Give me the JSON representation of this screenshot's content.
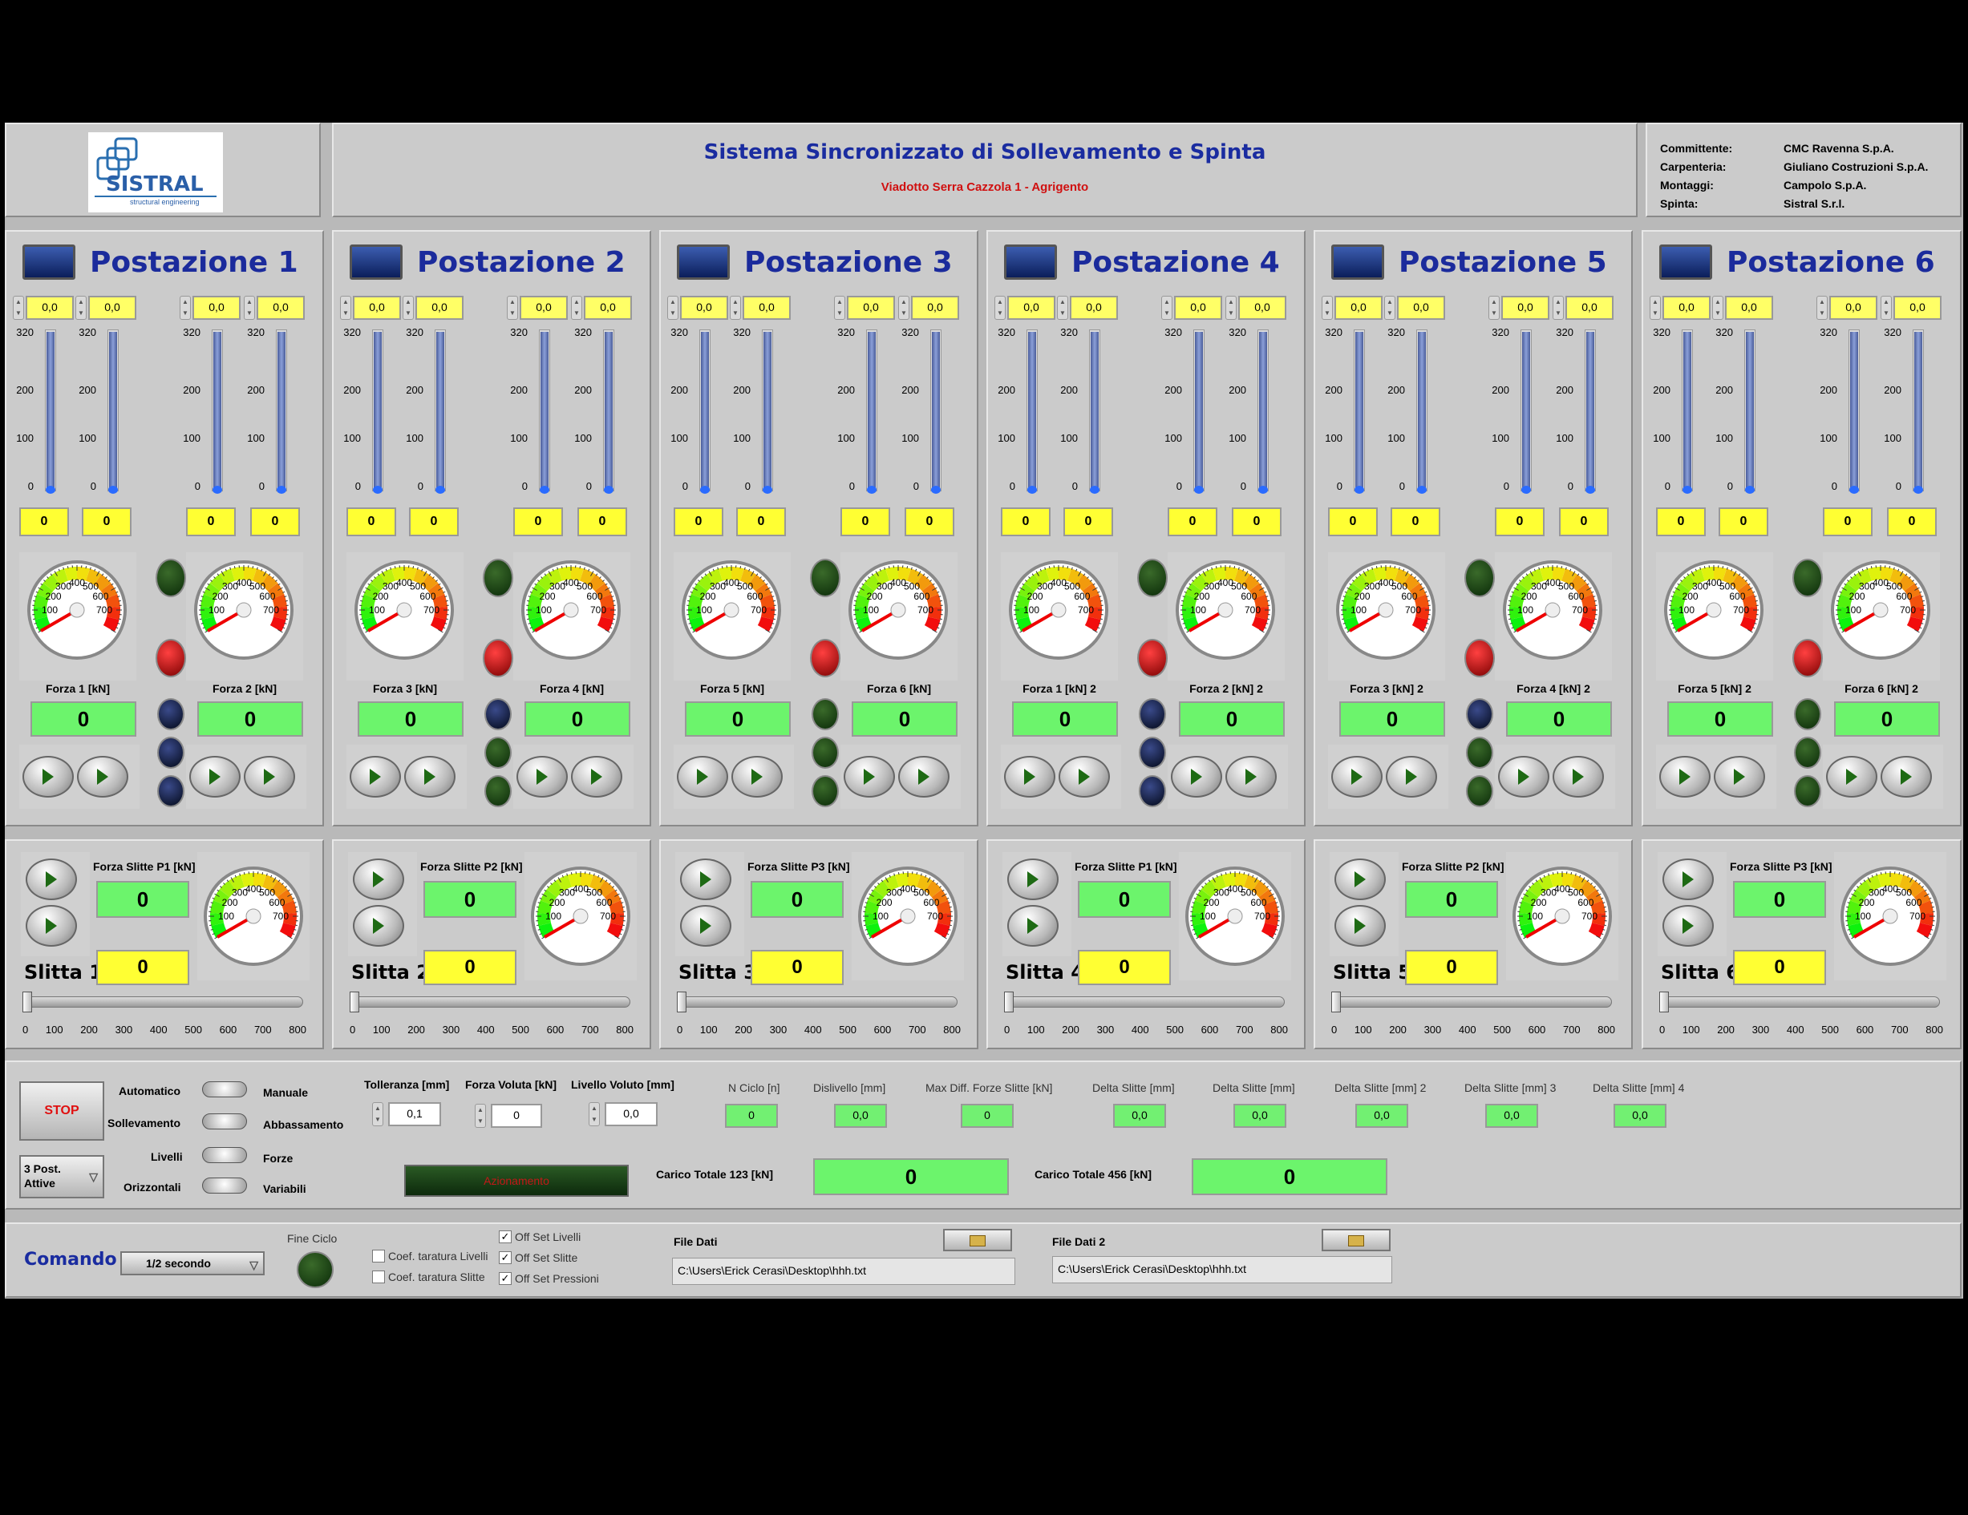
{
  "header": {
    "logo_text": "SISTRAL",
    "logo_sub": "structural engineering",
    "title": "Sistema Sincronizzato di Sollevamento e Spinta",
    "subtitle": "Viadotto Serra Cazzola 1 - Agrigento",
    "info": [
      {
        "label": "Committente:",
        "value": "CMC Ravenna S.p.A."
      },
      {
        "label": "Carpenteria:",
        "value": "Giuliano Costruzioni S.p.A."
      },
      {
        "label": "Montaggi:",
        "value": "Campolo S.p.A."
      },
      {
        "label": "Spinta:",
        "value": "Sistral S.r.l."
      }
    ]
  },
  "postazioni": [
    {
      "title": "Postazione 1",
      "g1": "Forza 1 [kN]",
      "g2": "Forza 2 [kN]",
      "side_leds": [
        "b",
        "b",
        "b"
      ]
    },
    {
      "title": "Postazione 2",
      "g1": "Forza 3 [kN]",
      "g2": "Forza 4 [kN]",
      "side_leds": [
        "b",
        "g",
        "g"
      ]
    },
    {
      "title": "Postazione 3",
      "g1": "Forza 5 [kN]",
      "g2": "Forza 6 [kN]",
      "side_leds": [
        "g",
        "g",
        "g"
      ]
    },
    {
      "title": "Postazione 4",
      "g1": "Forza 1 [kN] 2",
      "g2": "Forza 2 [kN] 2",
      "side_leds": [
        "b",
        "b",
        "b"
      ]
    },
    {
      "title": "Postazione 5",
      "g1": "Forza 3 [kN] 2",
      "g2": "Forza 4 [kN] 2",
      "side_leds": [
        "b",
        "g",
        "g"
      ]
    },
    {
      "title": "Postazione 6",
      "g1": "Forza 5 [kN] 2",
      "g2": "Forza 6 [kN] 2",
      "side_leds": [
        "g",
        "g",
        "g"
      ]
    }
  ],
  "postazione_values": {
    "spin_value": "0,0",
    "tank_value": "0",
    "force_value": "0",
    "tank_ticks": [
      "320",
      "200",
      "100",
      "0"
    ],
    "tank_levels": [
      0,
      0,
      0,
      0
    ]
  },
  "gauge": {
    "labels": [
      "100",
      "200",
      "300",
      "400",
      "500",
      "600",
      "700"
    ],
    "min": 0,
    "max": 800,
    "value": 0
  },
  "slitte": [
    {
      "title": "Slitta 1",
      "label": "Forza Slitte P1 [kN]"
    },
    {
      "title": "Slitta 2",
      "label": "Forza Slitte P2 [kN]"
    },
    {
      "title": "Slitta 3",
      "label": "Forza Slitte P3 [kN]"
    },
    {
      "title": "Slitta 4",
      "label": "Forza Slitte P1 [kN] 2"
    },
    {
      "title": "Slitta 5",
      "label": "Forza Slitte P2 [kN] 2"
    },
    {
      "title": "Slitta 6",
      "label": "Forza Slitte P3 [kN] 2"
    }
  ],
  "slitta_values": {
    "green_value": "0",
    "yellow_value": "0",
    "slider_value": 0,
    "slider_ticks": [
      "0",
      "100",
      "200",
      "300",
      "400",
      "500",
      "600",
      "700",
      "800"
    ]
  },
  "controls": {
    "stop_label": "STOP",
    "switches": [
      {
        "left": "Automatico",
        "right": "Manuale"
      },
      {
        "left": "Sollevamento",
        "right": "Abbassamento"
      },
      {
        "left": "Livelli",
        "right": "Forze"
      },
      {
        "left": "Orizzontali",
        "right": "Variabili"
      }
    ],
    "post_select": "3 Post. Attive",
    "tolleranza_label": "Tolleranza [mm]",
    "tolleranza_value": "0,1",
    "forza_voluta_label": "Forza Voluta [kN]",
    "forza_voluta_value": "0",
    "livello_voluto_label": "Livello Voluto [mm]",
    "livello_voluto_value": "0,0",
    "azionamento_label": "Azionamento",
    "readouts": [
      {
        "label": "N Ciclo [n]",
        "value": "0"
      },
      {
        "label": "Dislivello [mm]",
        "value": "0,0"
      },
      {
        "label": "Max Diff. Forze Slitte [kN]",
        "value": "0"
      },
      {
        "label": "Delta Slitte [mm]",
        "value": "0,0"
      },
      {
        "label": "Delta Slitte [mm]",
        "value": "0,0"
      },
      {
        "label": "Delta Slitte [mm] 2",
        "value": "0,0"
      },
      {
        "label": "Delta Slitte [mm] 3",
        "value": "0,0"
      },
      {
        "label": "Delta Slitte [mm] 4",
        "value": "0,0"
      }
    ],
    "carico1_label": "Carico Totale 123 [kN]",
    "carico1_value": "0",
    "carico2_label": "Carico Totale 456 [kN]",
    "carico2_value": "0"
  },
  "footer": {
    "comando_label": "Comando",
    "comando_value": "1/2 secondo",
    "fine_ciclo_label": "Fine Ciclo",
    "checks_left": [
      {
        "label": "Coef. taratura Livelli",
        "checked": false
      },
      {
        "label": "Coef. taratura Slitte",
        "checked": false
      }
    ],
    "checks_right": [
      {
        "label": "Off Set Livelli",
        "checked": true
      },
      {
        "label": "Off Set Slitte",
        "checked": true
      },
      {
        "label": "Off Set Pressioni",
        "checked": true
      }
    ],
    "file1_label": "File Dati",
    "file1_path": "C:\\Users\\Erick Cerasi\\Desktop\\hhh.txt",
    "file2_label": "File Dati 2",
    "file2_path": "C:\\Users\\Erick Cerasi\\Desktop\\hhh.txt",
    "check_mark": "✓"
  }
}
